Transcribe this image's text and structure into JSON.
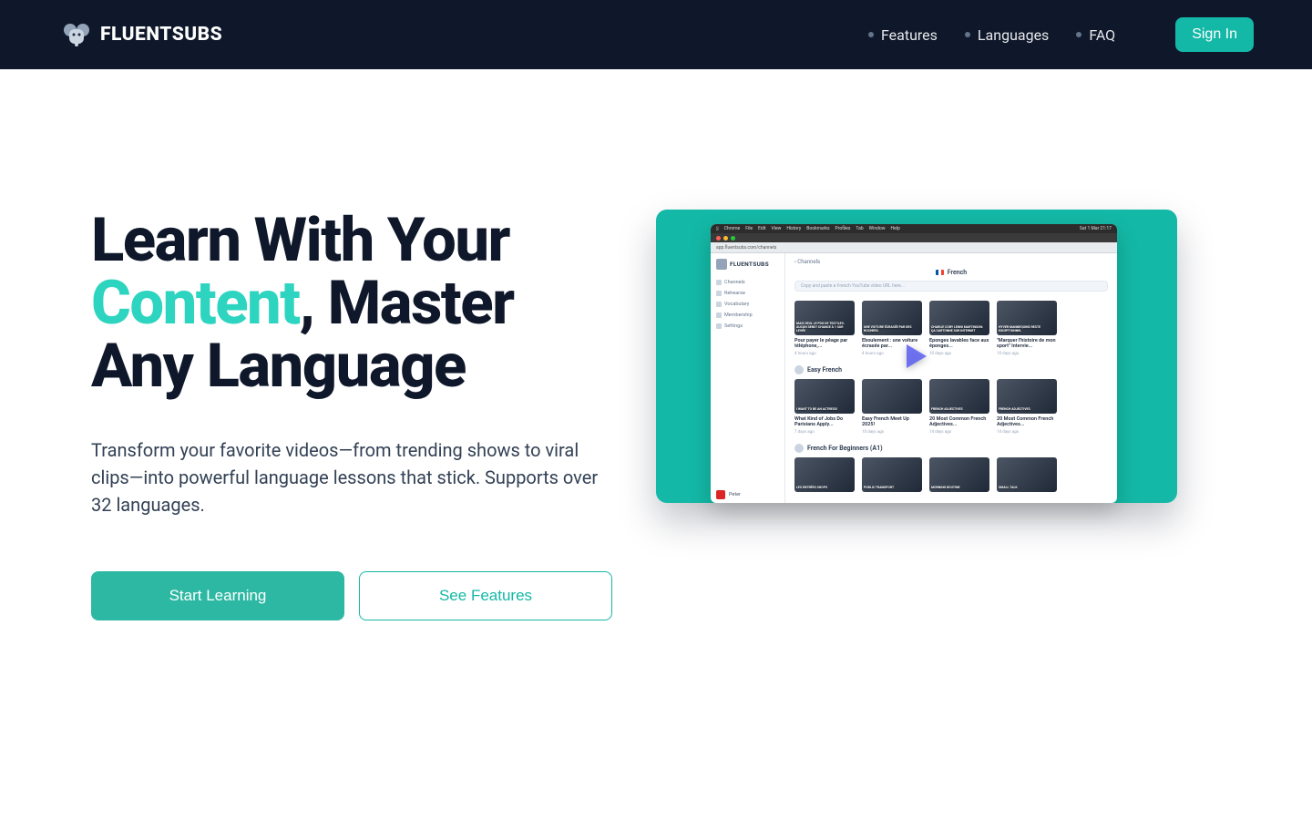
{
  "brand": "FLUENTSUBS",
  "nav": {
    "features": "Features",
    "languages": "Languages",
    "faq": "FAQ"
  },
  "signin": "Sign In",
  "hero": {
    "title_1": "Learn With Your ",
    "title_accent": "Content",
    "title_2": ", Master Any Language",
    "sub": "Transform your favorite videos—from trending shows to viral clips—into powerful language lessons that stick. Supports over 32 languages.",
    "cta_primary": "Start Learning",
    "cta_secondary": "See Features"
  },
  "preview": {
    "mac_menu": [
      "Chrome",
      "File",
      "Edit",
      "View",
      "History",
      "Bookmarks",
      "Profiles",
      "Tab",
      "Window",
      "Help"
    ],
    "mac_time": "Sat 1 Mar 21:17",
    "url": "app.fluentsubs.com/channels",
    "sidebar_brand": "FLUENTSUBS",
    "sidebar": [
      "Channels",
      "Rehearse",
      "Vocabulary",
      "Membership",
      "Settings"
    ],
    "breadcrumb": "Channels",
    "language": "French",
    "search_placeholder": "Copy and paste a French YouTube video URL here...",
    "row1": [
      {
        "overlay": "MAIS SEUL LE PDG DE TEXTILES: AUCUN SENS? CHANCE À 1 SUR LEVÉE",
        "title": "Pour payer le péage par téléphone,...",
        "meta": "4 hours ago"
      },
      {
        "overlay": "UNE VOITURE ÉCRASÉE PAR DES ROCHERS",
        "title": "Éboulement : une voiture écrasée par...",
        "meta": "4 hours ago"
      },
      {
        "overlay": "CHARLIE COBY LENNI MARTINSON: ÇA CARTONNE SUR INTERNET",
        "title": "Éponges lavables face aux éponges...",
        "meta": "10 days ago"
      },
      {
        "overlay": "HYVER MANNEQUINS RESTE EXCEPTIONNEL",
        "title": "\"Marquer l'histoire de mon sport\" Intervie...",
        "meta": "10 days ago"
      }
    ],
    "section1": "Easy French",
    "row2": [
      {
        "overlay": "I WANT TO BE AN ACTRESS!",
        "title": "What Kind of Jobs Do Parisians Apply...",
        "meta": "7 days ago"
      },
      {
        "overlay": "",
        "title": "Easy French Meet Up 2025!",
        "meta": "10 days ago"
      },
      {
        "overlay": "FRENCH ADJECTIVES",
        "title": "20 Most Common French Adjectives...",
        "meta": "14 days ago"
      },
      {
        "overlay": "FRENCH ADJECTIVES",
        "title": "20 Most Common French Adjectives...",
        "meta": "14 days ago"
      }
    ],
    "section2": "French For Beginners (A1)",
    "row3": [
      {
        "overlay": "LES ENTRÉES SHOPS"
      },
      {
        "overlay": "PUBLIC TRANSPORT"
      },
      {
        "overlay": "MORNING ROUTINE"
      },
      {
        "overlay": "SMALL TALK"
      }
    ],
    "user": "Peter"
  }
}
